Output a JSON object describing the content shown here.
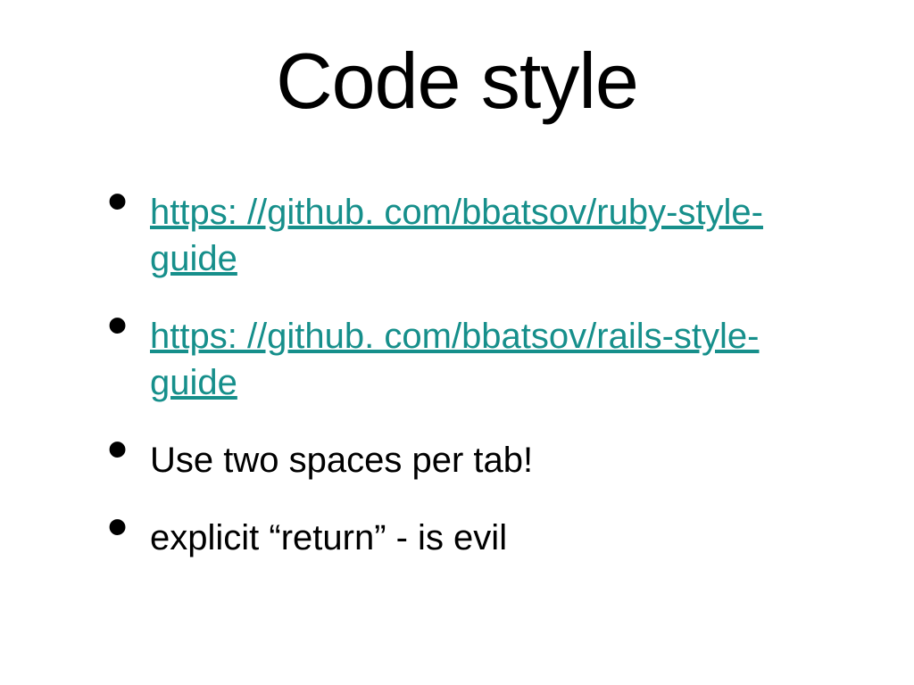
{
  "slide": {
    "title": "Code style",
    "items": [
      {
        "type": "link",
        "text": "https: //github. com/bbatsov/ruby-style-guide"
      },
      {
        "type": "link",
        "text": "https: //github. com/bbatsov/rails-style-guide"
      },
      {
        "type": "text",
        "text": "Use two spaces per tab!"
      },
      {
        "type": "text",
        "text": "explicit “return” - is evil"
      }
    ]
  }
}
